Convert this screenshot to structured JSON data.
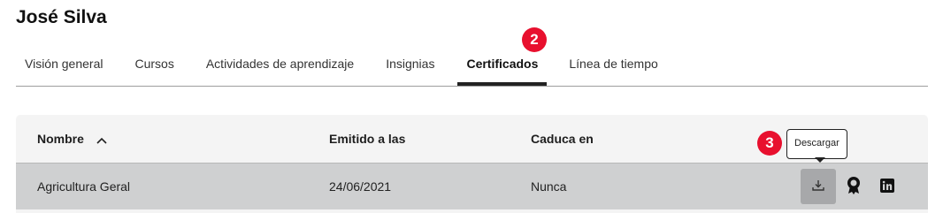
{
  "user": {
    "name": "José Silva"
  },
  "tabs": [
    {
      "label": "Visión general"
    },
    {
      "label": "Cursos"
    },
    {
      "label": "Actividades de aprendizaje"
    },
    {
      "label": "Insignias"
    },
    {
      "label": "Certificados",
      "active": true
    },
    {
      "label": "Línea de tiempo"
    }
  ],
  "steps": {
    "tab_step": "2",
    "action_step": "3"
  },
  "table": {
    "headers": {
      "name": "Nombre",
      "issued": "Emitido a las",
      "expires": "Caduca en"
    },
    "sort": {
      "column": "name",
      "direction": "ascending",
      "icon": "chevron-up-icon"
    },
    "rows": [
      {
        "name": "Agricultura Geral",
        "issued": "24/06/2021",
        "expires": "Nunca",
        "actions": [
          "download-icon",
          "award-ribbon-icon",
          "linkedin-icon"
        ]
      }
    ]
  },
  "tooltip": {
    "download": "Descargar"
  },
  "colors": {
    "badge": "#e8102e",
    "header_bg": "#f4f4f4",
    "row_bg": "#cfd0d1",
    "download_btn_bg": "#a7a8aa",
    "active_tab_underline": "#222222"
  }
}
